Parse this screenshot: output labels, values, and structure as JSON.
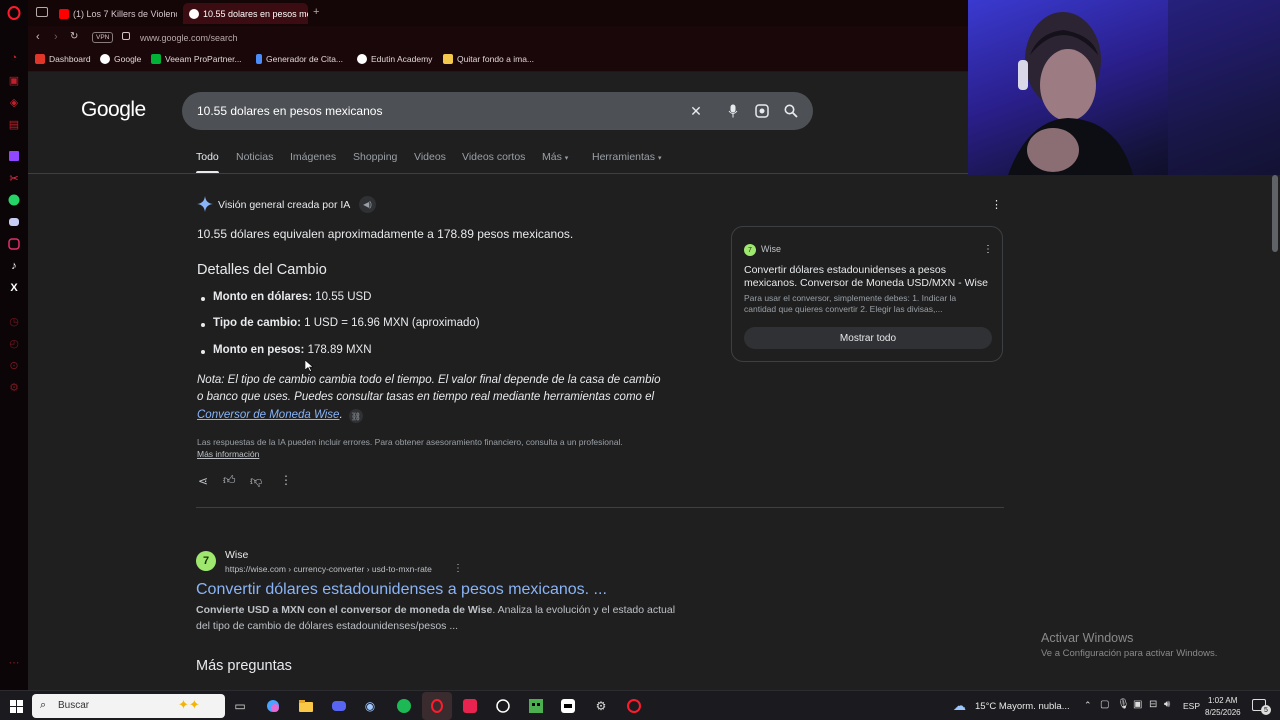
{
  "browser": {
    "tabs": [
      {
        "label": "(1) Los 7 Killers de Violenc",
        "active": false
      },
      {
        "label": "10.55 dolares en pesos me",
        "active": true
      }
    ],
    "new_tab": "+",
    "vpn_label": "VPN",
    "url": "www.google.com/search",
    "bookmarks": [
      "Dashboard",
      "Google",
      "Veeam ProPartner...",
      "Generador de Cita...",
      "Edutin Academy",
      "Quitar fondo a ima..."
    ]
  },
  "google": {
    "logo": "Google",
    "query": "10.55 dolares en pesos mexicanos",
    "nav_tabs": [
      "Todo",
      "Noticias",
      "Imágenes",
      "Shopping",
      "Videos",
      "Videos cortos",
      "Más",
      "Herramientas"
    ],
    "ai_overview": {
      "header": "Visión general creada por IA",
      "summary": "10.55 dólares equivalen aproximadamente a 178.89 pesos mexicanos.",
      "section_title": "Detalles del Cambio",
      "items": [
        {
          "label": "Monto en dólares:",
          "value": " 10.55 USD"
        },
        {
          "label": "Tipo de cambio:",
          "value": " 1 USD = 16.96 MXN (aproximado)"
        },
        {
          "label": "Monto en pesos:",
          "value": " 178.89 MXN"
        }
      ],
      "note_line1": "Nota: El tipo de cambio cambia todo el tiempo. El valor final depende de la casa de cambio",
      "note_line2": "o banco que uses. Puedes consultar tasas en tiempo real mediante herramientas como el",
      "note_link": "Conversor de Moneda Wise",
      "note_end": ".",
      "disclaimer": "Las respuestas de la IA pueden incluir errores. Para obtener asesoramiento financiero, consulta a un profesional.",
      "more_info": "Más información"
    },
    "source_card": {
      "site": "Wise",
      "title_line1": "Convertir dólares estadounidenses a pesos",
      "title_line2": "mexicanos. Conversor de Moneda USD/MXN - Wise",
      "desc_line1": "Para usar el conversor, simplemente debes: 1. Indicar la",
      "desc_line2": "cantidad que quieres convertir 2. Elegir las divisas,...",
      "button": "Mostrar todo"
    },
    "result": {
      "site": "Wise",
      "url": "https://wise.com › currency-converter › usd-to-mxn-rate",
      "title": "Convertir dólares estadounidenses a pesos mexicanos. ...",
      "snippet_bold": "Convierte USD a MXN con el conversor de moneda de Wise",
      "snippet_rest": ". Analiza la evolución y el estado actual del tipo de cambio de dólares estadounidenses/pesos ..."
    },
    "more_questions": "Más preguntas"
  },
  "windows": {
    "activate_title": "Activar Windows",
    "activate_sub": "Ve a Configuración para activar Windows.",
    "search_placeholder": "Buscar",
    "weather": "15°C  Mayorm. nubla...",
    "lang": "ESP",
    "time": "1:02 AM",
    "date": "8/25/2026",
    "notif_count": "5"
  },
  "colors": {
    "accent_link": "#8ab4f8",
    "opera_red": "#ff1b2d",
    "wise_green": "#9fe870"
  }
}
